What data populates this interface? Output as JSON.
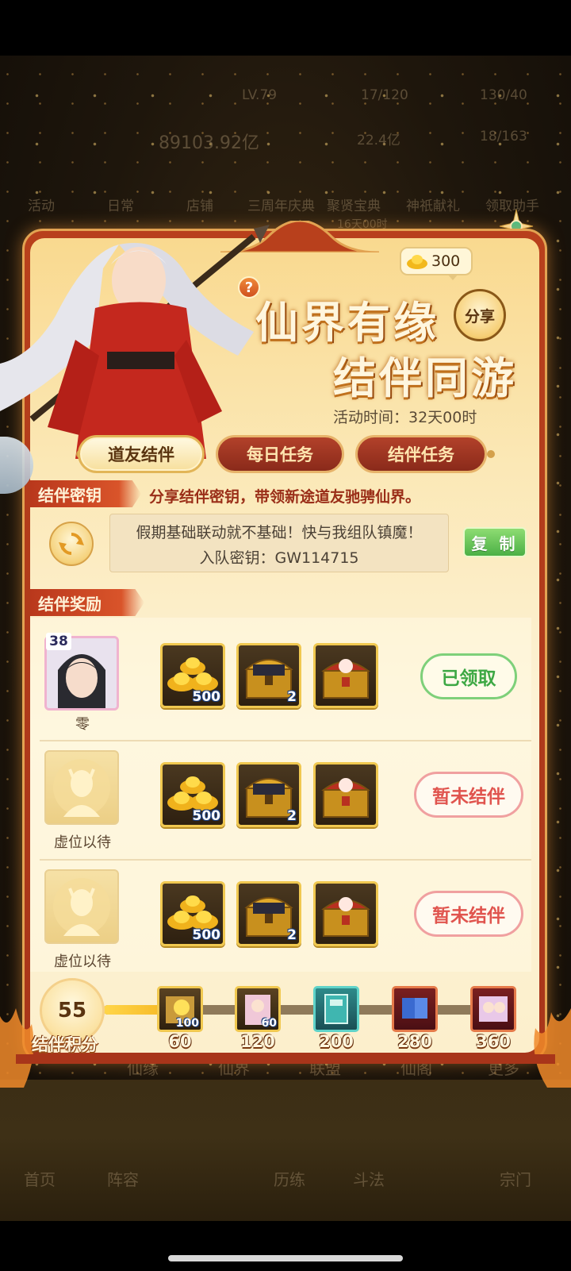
{
  "background_menu": {
    "top_stats": [
      "LV.79",
      "17/120",
      "130/40",
      "89103.92亿",
      "22.4亿",
      "18/163"
    ],
    "icons": [
      "活动",
      "日常",
      "店铺",
      "三周年庆典",
      "聚贤宝典",
      "神祇献礼",
      "领取助手"
    ],
    "icon_subtext": "16天00时",
    "bottom_nav_upper": [
      "仙缘",
      "仙界",
      "联盟",
      "仙阁",
      "更多"
    ],
    "bottom_nav_lower": [
      "首页",
      "阵容",
      "历练",
      "斗法",
      "宗门"
    ]
  },
  "currency": {
    "ingot_count": "300"
  },
  "title": {
    "line1": "仙界有缘",
    "line2": "结伴同游"
  },
  "share_label": "分享",
  "event_time": "活动时间：32天00时",
  "tabs": [
    {
      "label": "道友结伴",
      "active": true
    },
    {
      "label": "每日任务",
      "active": false
    },
    {
      "label": "结伴任务",
      "active": false
    }
  ],
  "key_section": {
    "header": "结伴密钥",
    "description": "分享结伴密钥，带领新途道友驰骋仙界。",
    "message": "假期基础联动就不基础！快与我组队镇魔！",
    "code_text": "入队密钥：GW114715",
    "copy_label": "复 制"
  },
  "reward_section": {
    "header": "结伴奖励",
    "rows": [
      {
        "name": "零",
        "level": "38",
        "status": "已领取",
        "items": [
          {
            "qty": "500"
          },
          {
            "qty": "2"
          },
          {
            "qty": ""
          }
        ]
      },
      {
        "name": "虚位以待",
        "level": "",
        "status": "暂未结伴",
        "items": [
          {
            "qty": "500"
          },
          {
            "qty": "2"
          },
          {
            "qty": ""
          }
        ]
      },
      {
        "name": "虚位以待",
        "level": "",
        "status": "暂未结伴",
        "items": [
          {
            "qty": "500"
          },
          {
            "qty": "2"
          },
          {
            "qty": ""
          }
        ]
      }
    ]
  },
  "progress": {
    "score": "55",
    "label": "结伴积分",
    "max": 360,
    "current": 55,
    "nodes": [
      {
        "threshold": "60",
        "qty": "100"
      },
      {
        "threshold": "120",
        "qty": "60"
      },
      {
        "threshold": "200",
        "qty": ""
      },
      {
        "threshold": "280",
        "qty": ""
      },
      {
        "threshold": "360",
        "qty": ""
      }
    ]
  },
  "colors": {
    "accent_red": "#b9381c",
    "gold": "#f0c850",
    "claimed_green": "#3da844",
    "unpaired_red": "#e0544e"
  }
}
